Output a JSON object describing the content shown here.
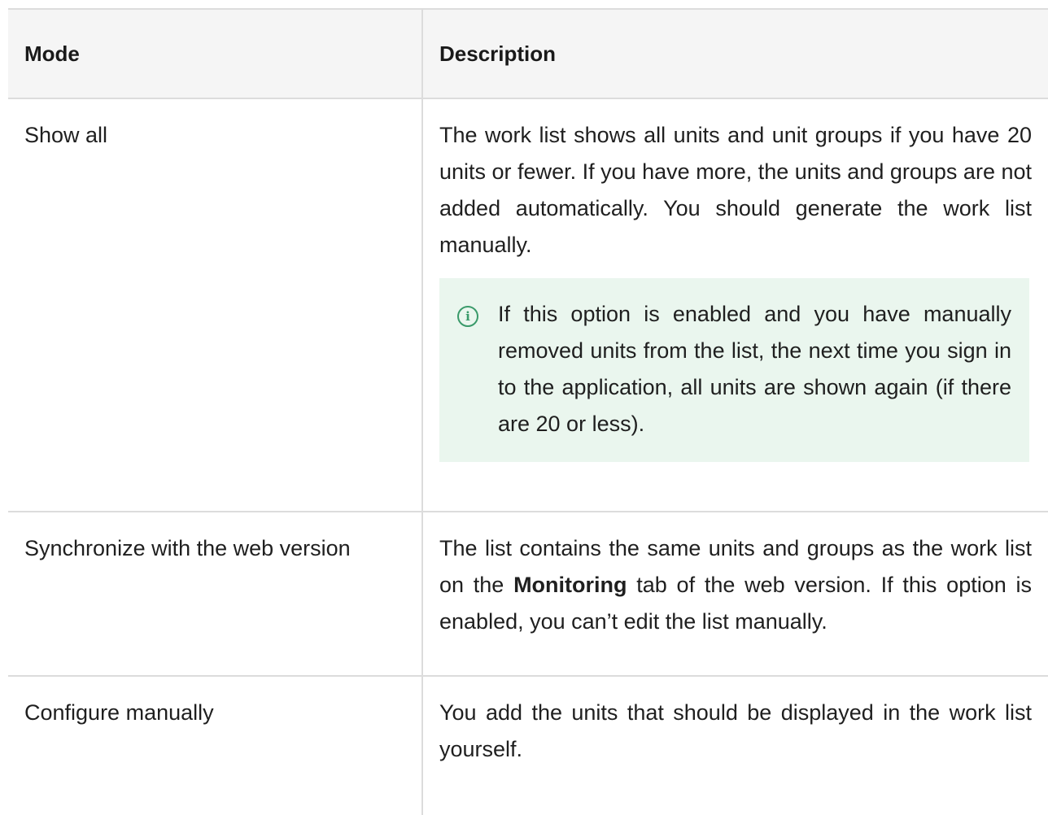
{
  "table": {
    "headers": {
      "mode": "Mode",
      "description": "Description"
    },
    "rows": [
      {
        "mode": "Show all",
        "description": "The work list shows all units and unit groups if you have 20 units or fewer. If you have more, the units and groups are not added automatically. You should generate the work list manually.",
        "note": "If this option is enabled and you have manually removed units from the list, the next time you sign in to the application, all units are shown again (if there are 20 or less)."
      },
      {
        "mode": "Synchronize with the web version",
        "description_before": "The list contains the same units and groups as the work list on the ",
        "description_bold": "Monitoring",
        "description_after": " tab of the web version. If this option is enabled, you can’t edit the list manually."
      },
      {
        "mode": "Configure manually",
        "description": "You add the units that should be displayed in the work list yourself."
      }
    ]
  },
  "icons": {
    "note": "info-icon"
  },
  "colors": {
    "note_bg": "#eaf6ee",
    "note_icon": "#3a9a6a",
    "header_bg": "#f5f5f5"
  }
}
